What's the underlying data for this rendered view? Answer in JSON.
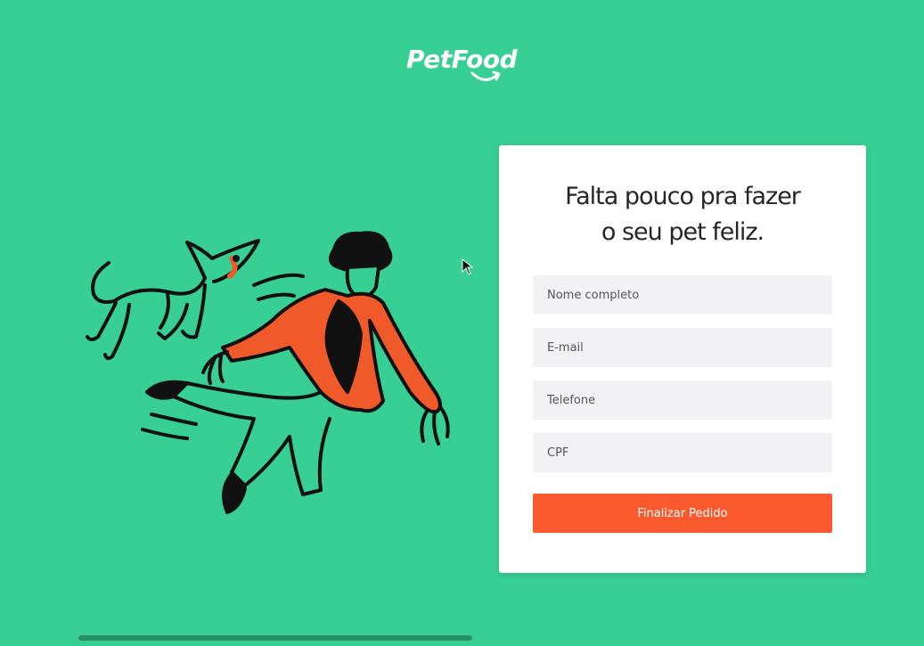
{
  "brand": {
    "name": "PetFood",
    "color": "#37cf93"
  },
  "form": {
    "title_line1": "Falta pouco pra fazer",
    "title_line2": "o seu pet feliz.",
    "fields": [
      {
        "placeholder": "Nome completo"
      },
      {
        "placeholder": "E-mail"
      },
      {
        "placeholder": "Telefone"
      },
      {
        "placeholder": "CPF"
      }
    ],
    "submit_label": "Finalizar Pedido",
    "submit_color": "#fa5a2d"
  },
  "illustration": {
    "icon": "person-running-with-dog-illustration",
    "accent_color": "#f05a2b"
  },
  "cursor": {
    "icon": "mouse-pointer-icon"
  }
}
